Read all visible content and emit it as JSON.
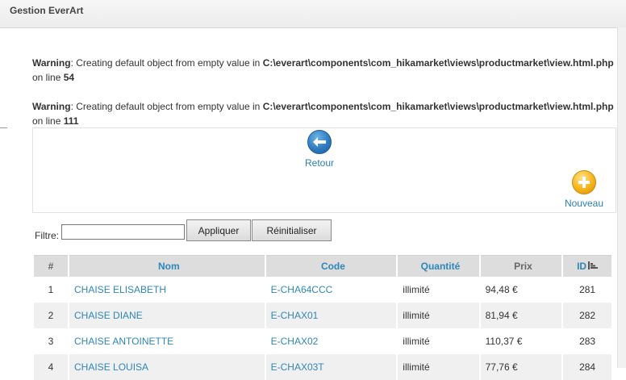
{
  "header": {
    "title": "Gestion EverArt"
  },
  "warnings": [
    {
      "label": "Warning",
      "message": ": Creating default object from empty value in ",
      "path": "C:\\everart\\components\\com_hikamarket\\views\\productmarket\\view.html.php",
      "line_prefix": "on line ",
      "line": "54"
    },
    {
      "label": "Warning",
      "message": ": Creating default object from empty value in ",
      "path": "C:\\everart\\components\\com_hikamarket\\views\\productmarket\\view.html.php",
      "line_prefix": "on line ",
      "line": "111"
    }
  ],
  "toolbar": {
    "back_label": "Retour",
    "back_icon": "back-arrow-icon",
    "new_label": "Nouveau",
    "new_icon": "plus-icon"
  },
  "filter": {
    "label": "Filtre:",
    "value": "",
    "apply_label": "Appliquer",
    "reset_label": "Réinitialiser"
  },
  "table": {
    "headers": {
      "num": "#",
      "nom": "Nom",
      "code": "Code",
      "quantite": "Quantité",
      "prix": "Prix",
      "id": "ID"
    },
    "rows": [
      {
        "num": "1",
        "nom": "CHAISE ELISABETH",
        "code": "E-CHA64CCC",
        "quantite": "illimité",
        "prix": "94,48 €",
        "id": "281"
      },
      {
        "num": "2",
        "nom": "CHAISE DIANE",
        "code": "E-CHAX01",
        "quantite": "illimité",
        "prix": "81,94 €",
        "id": "282"
      },
      {
        "num": "3",
        "nom": "CHAISE ANTOINETTE",
        "code": "E-CHAX02",
        "quantite": "illimité",
        "prix": "110,37 €",
        "id": "283"
      },
      {
        "num": "4",
        "nom": "CHAISE LOUISA",
        "code": "E-CHAX03T",
        "quantite": "illimité",
        "prix": "77,76 €",
        "id": "284"
      }
    ]
  },
  "colors": {
    "link": "#2d87b9",
    "header_bg": "#dddddd",
    "alt_row": "#f0f0f0"
  }
}
